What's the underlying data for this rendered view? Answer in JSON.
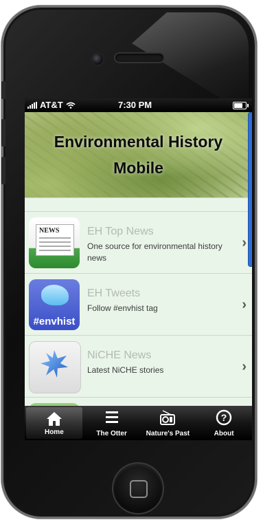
{
  "status_bar": {
    "carrier": "AT&T",
    "time": "7:30 PM"
  },
  "banner": {
    "title_line1": "Environmental History",
    "title_line2": "Mobile"
  },
  "list_items": [
    {
      "title": "EH Top News",
      "subtitle": "One source for environmental history news",
      "icon": "newspaper-icon",
      "thumb_text": "NEWS"
    },
    {
      "title": "EH Tweets",
      "subtitle": "Follow #envhist tag",
      "icon": "twitter-bird-icon",
      "thumb_text": "#envhist"
    },
    {
      "title": "NiCHE News",
      "subtitle": "Latest NiCHE stories",
      "icon": "maple-leaf-icon"
    }
  ],
  "tab_bar": {
    "tabs": [
      {
        "label": "Home",
        "icon": "home-icon",
        "active": true
      },
      {
        "label": "The Otter",
        "icon": "list-icon",
        "active": false
      },
      {
        "label": "Nature's Past",
        "icon": "radio-icon",
        "active": false
      },
      {
        "label": "About",
        "icon": "help-icon",
        "active": false
      }
    ]
  },
  "colors": {
    "list_background": "#e9f5e9",
    "title_text": "#b3bab3",
    "scrollbar": "#2f6fd6",
    "tab_bar": "#151515"
  }
}
